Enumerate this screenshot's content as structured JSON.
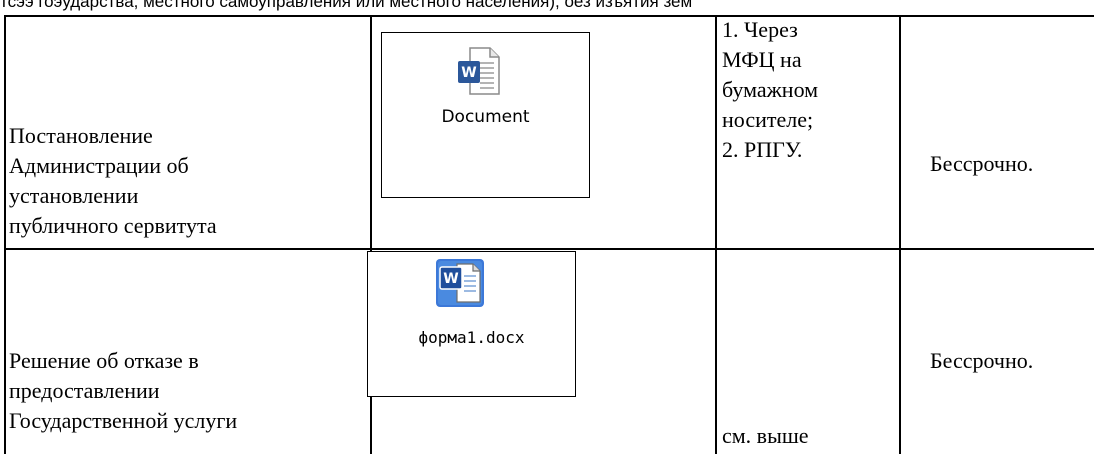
{
  "header_strip": {
    "text": "тсээ гоэударства, местного самоуправления или местного населения), оез изъятия зем"
  },
  "rows": [
    {
      "document_name_lines": [
        "Постановление",
        "Администрации об",
        "установлении",
        "публичного сервитута"
      ],
      "attachment": {
        "caption": "Document",
        "icon": "word-document-icon"
      },
      "delivery_lines": [
        "1. Через",
        "МФЦ на",
        "бумажном",
        "носителе;",
        "2. РПГУ."
      ],
      "term": "Бессрочно."
    },
    {
      "document_name_lines": [
        "Решение об отказе в",
        "предоставлении",
        "Государственной услуги"
      ],
      "attachment": {
        "caption": "форма1.docx",
        "icon": "word-docx-icon"
      },
      "delivery_lines": [
        "см. выше"
      ],
      "term": "Бессрочно."
    }
  ],
  "colors": {
    "word_blue": "#2b579a",
    "word_blue_light": "#3c78d8",
    "page_white": "#ffffff",
    "border": "#000000"
  }
}
